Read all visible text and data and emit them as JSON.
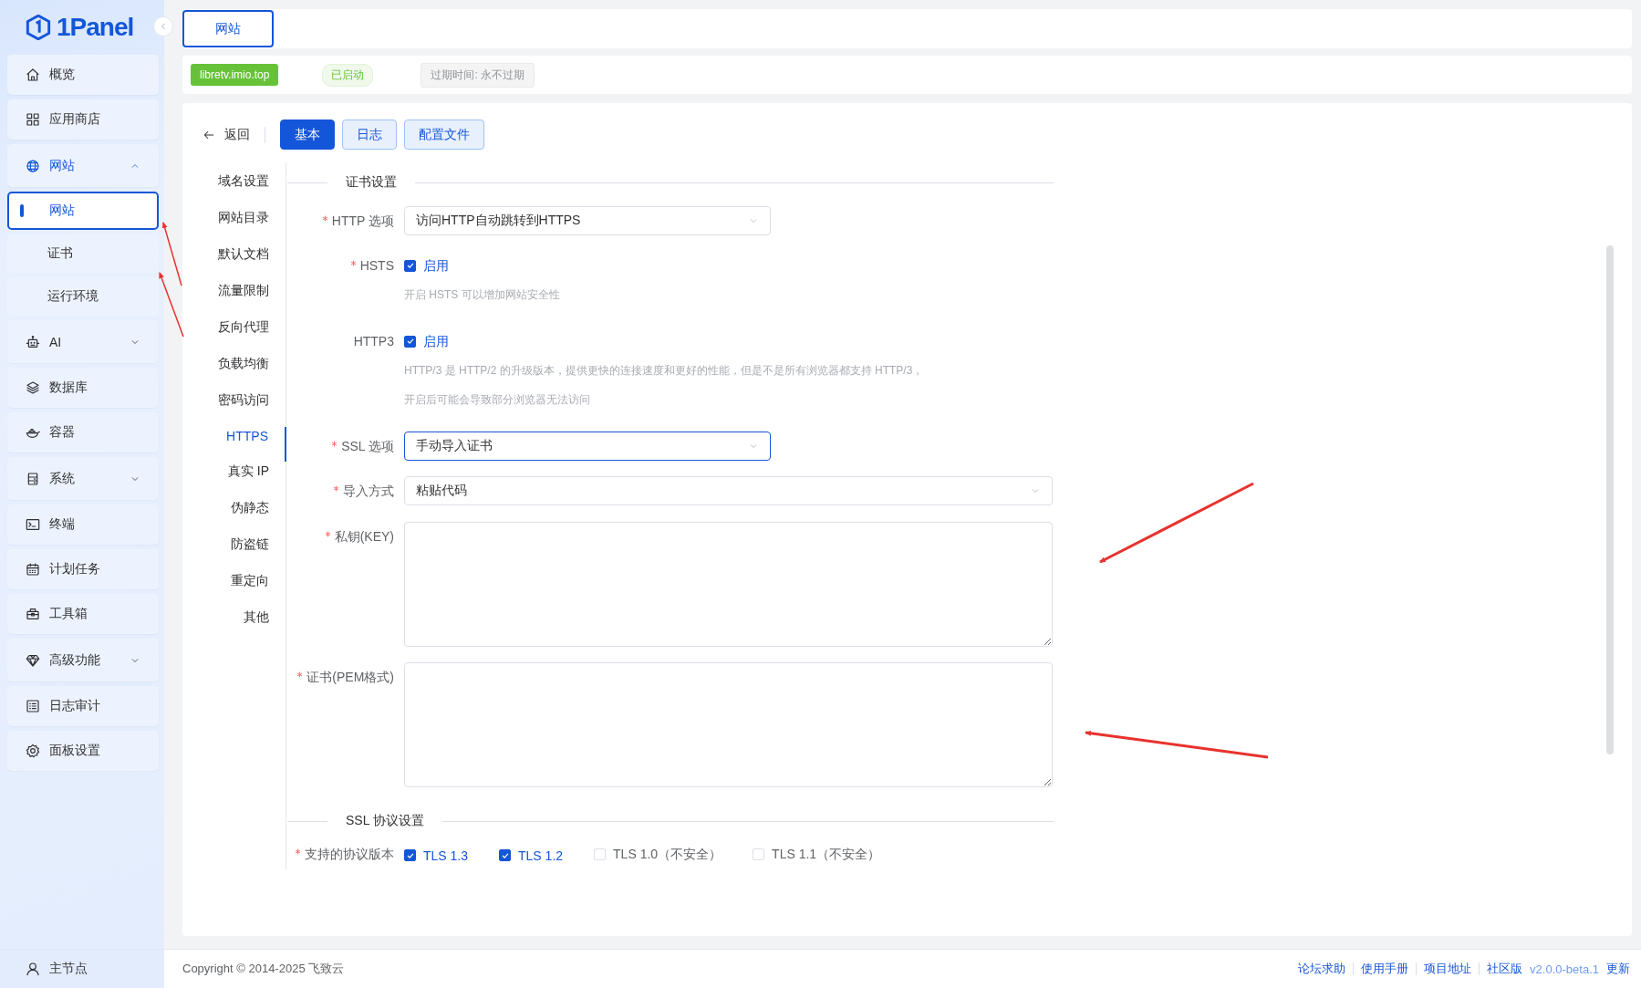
{
  "sidebar": {
    "logo": "1Panel",
    "items": [
      {
        "label": "概览",
        "kind": "link",
        "selected": false
      },
      {
        "label": "应用商店",
        "kind": "link",
        "selected": false
      },
      {
        "label": "网站",
        "kind": "group",
        "selected": true,
        "expanded": true,
        "children": [
          {
            "label": "网站",
            "selected": true
          },
          {
            "label": "证书",
            "selected": false
          },
          {
            "label": "运行环境",
            "selected": false
          }
        ]
      },
      {
        "label": "AI",
        "kind": "group",
        "selected": false,
        "expanded": false
      },
      {
        "label": "数据库",
        "kind": "link",
        "selected": false
      },
      {
        "label": "容器",
        "kind": "link",
        "selected": false
      },
      {
        "label": "系统",
        "kind": "group",
        "selected": false,
        "expanded": false
      },
      {
        "label": "终端",
        "kind": "link",
        "selected": false
      },
      {
        "label": "计划任务",
        "kind": "link",
        "selected": false
      },
      {
        "label": "工具箱",
        "kind": "link",
        "selected": false
      },
      {
        "label": "高级功能",
        "kind": "group",
        "selected": false,
        "expanded": false
      },
      {
        "label": "日志审计",
        "kind": "link",
        "selected": false
      },
      {
        "label": "面板设置",
        "kind": "link",
        "selected": false
      }
    ],
    "node": "主节点"
  },
  "tabs": [
    {
      "label": "网站",
      "selected": true
    }
  ],
  "site_bar": {
    "domain": "libretv.imio.top",
    "status": "已启动",
    "expiry": "过期时间: 永不过期"
  },
  "back": "返回",
  "view_tabs": [
    {
      "label": "基本",
      "selected": true
    },
    {
      "label": "日志",
      "selected": false
    },
    {
      "label": "配置文件",
      "selected": false
    }
  ],
  "nav": [
    {
      "label": "域名设置",
      "selected": false
    },
    {
      "label": "网站目录",
      "selected": false
    },
    {
      "label": "默认文档",
      "selected": false
    },
    {
      "label": "流量限制",
      "selected": false
    },
    {
      "label": "反向代理",
      "selected": false
    },
    {
      "label": "负载均衡",
      "selected": false
    },
    {
      "label": "密码访问",
      "selected": false
    },
    {
      "label": "HTTPS",
      "selected": true
    },
    {
      "label": "真实 IP",
      "selected": false
    },
    {
      "label": "伪静态",
      "selected": false
    },
    {
      "label": "防盗链",
      "selected": false
    },
    {
      "label": "重定向",
      "selected": false
    },
    {
      "label": "其他",
      "selected": false
    }
  ],
  "sections": [
    {
      "title": "证书设置",
      "fields": [
        {
          "kind": "select",
          "label": "HTTP 选项",
          "required": true,
          "value": "访问HTTP自动跳转到HTTPS",
          "focused": false
        },
        {
          "kind": "checkbox",
          "label": "HSTS",
          "required": true,
          "option": "启用",
          "checked": true,
          "help": [
            "开启 HSTS 可以增加网站安全性"
          ]
        },
        {
          "kind": "checkbox",
          "label": "HTTP3",
          "required": false,
          "option": "启用",
          "checked": true,
          "help": [
            "HTTP/3 是 HTTP/2 的升级版本，提供更快的连接速度和更好的性能，但是不是所有浏览器都支持 HTTP/3，",
            "开启后可能会导致部分浏览器无法访问"
          ]
        },
        {
          "kind": "select",
          "label": "SSL 选项",
          "required": true,
          "value": "手动导入证书",
          "focused": true
        },
        {
          "kind": "select-wide",
          "label": "导入方式",
          "required": true,
          "value": "粘贴代码",
          "focused": false
        },
        {
          "kind": "textarea",
          "label": "私钥(KEY)",
          "required": true
        },
        {
          "kind": "textarea",
          "label": "证书(PEM格式)",
          "required": true
        }
      ]
    },
    {
      "title": "SSL 协议设置",
      "fields": [
        {
          "kind": "checkgroup",
          "label": "支持的协议版本",
          "required": true,
          "options": [
            {
              "label": "TLS 1.3",
              "checked": true
            },
            {
              "label": "TLS 1.2",
              "checked": true
            },
            {
              "label": "TLS 1.0（不安全）",
              "checked": false
            },
            {
              "label": "TLS 1.1（不安全）",
              "checked": false
            }
          ]
        }
      ]
    }
  ],
  "footer": {
    "copyright": "Copyright © 2014-2025 飞致云",
    "links": [
      "论坛求助",
      "使用手册",
      "项目地址",
      "社区版"
    ],
    "version": "v2.0.0-beta.1",
    "update": "更新"
  }
}
